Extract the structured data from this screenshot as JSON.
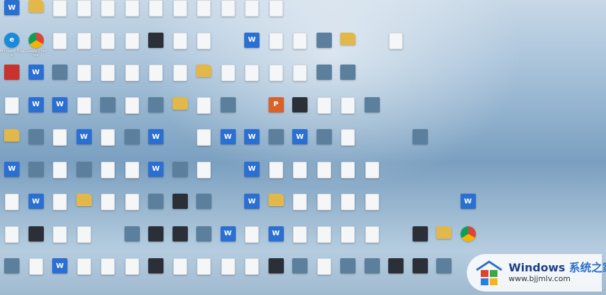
{
  "desktop": {
    "icons": [
      {
        "label": "",
        "kind": "word",
        "col": 0,
        "row": 0
      },
      {
        "label": "",
        "kind": "folder",
        "col": 1,
        "row": 0
      },
      {
        "label": "",
        "kind": "doc",
        "col": 2,
        "row": 0
      },
      {
        "label": "",
        "kind": "doc",
        "col": 3,
        "row": 0
      },
      {
        "label": "",
        "kind": "doc",
        "col": 4,
        "row": 0
      },
      {
        "label": "",
        "kind": "doc",
        "col": 5,
        "row": 0
      },
      {
        "label": "",
        "kind": "doc",
        "col": 6,
        "row": 0
      },
      {
        "label": "",
        "kind": "doc",
        "col": 7,
        "row": 0
      },
      {
        "label": "",
        "kind": "doc",
        "col": 8,
        "row": 0
      },
      {
        "label": "",
        "kind": "doc",
        "col": 9,
        "row": 0
      },
      {
        "label": "",
        "kind": "doc",
        "col": 10,
        "row": 0
      },
      {
        "label": "",
        "kind": "doc",
        "col": 11,
        "row": 0
      },
      {
        "label": "Microsoft Edge",
        "kind": "edge",
        "col": 0,
        "row": 1
      },
      {
        "label": "Google Chrome",
        "kind": "chrome",
        "col": 1,
        "row": 1
      },
      {
        "label": "",
        "kind": "doc",
        "col": 2,
        "row": 1
      },
      {
        "label": "",
        "kind": "doc",
        "col": 3,
        "row": 1
      },
      {
        "label": "",
        "kind": "doc",
        "col": 4,
        "row": 1
      },
      {
        "label": "",
        "kind": "doc",
        "col": 5,
        "row": 1
      },
      {
        "label": "",
        "kind": "dark",
        "col": 6,
        "row": 1
      },
      {
        "label": "",
        "kind": "doc",
        "col": 7,
        "row": 1
      },
      {
        "label": "",
        "kind": "doc",
        "col": 8,
        "row": 1
      },
      {
        "label": "",
        "kind": "word",
        "col": 10,
        "row": 1
      },
      {
        "label": "",
        "kind": "doc",
        "col": 11,
        "row": 1
      },
      {
        "label": "",
        "kind": "doc",
        "col": 12,
        "row": 1
      },
      {
        "label": "",
        "kind": "photo",
        "col": 13,
        "row": 1
      },
      {
        "label": "",
        "kind": "folder",
        "col": 14,
        "row": 1
      },
      {
        "label": "",
        "kind": "doc",
        "col": 16,
        "row": 1
      },
      {
        "label": "",
        "kind": "red",
        "col": 0,
        "row": 2
      },
      {
        "label": "",
        "kind": "word",
        "col": 1,
        "row": 2
      },
      {
        "label": "",
        "kind": "photo",
        "col": 2,
        "row": 2
      },
      {
        "label": "",
        "kind": "doc",
        "col": 3,
        "row": 2
      },
      {
        "label": "",
        "kind": "doc",
        "col": 4,
        "row": 2
      },
      {
        "label": "",
        "kind": "doc",
        "col": 5,
        "row": 2
      },
      {
        "label": "",
        "kind": "doc",
        "col": 6,
        "row": 2
      },
      {
        "label": "",
        "kind": "doc",
        "col": 7,
        "row": 2
      },
      {
        "label": "",
        "kind": "folder",
        "col": 8,
        "row": 2
      },
      {
        "label": "",
        "kind": "doc",
        "col": 9,
        "row": 2
      },
      {
        "label": "",
        "kind": "doc",
        "col": 10,
        "row": 2
      },
      {
        "label": "",
        "kind": "doc",
        "col": 11,
        "row": 2
      },
      {
        "label": "",
        "kind": "doc",
        "col": 12,
        "row": 2
      },
      {
        "label": "",
        "kind": "photo",
        "col": 13,
        "row": 2
      },
      {
        "label": "",
        "kind": "photo",
        "col": 14,
        "row": 2
      },
      {
        "label": "",
        "kind": "doc",
        "col": 0,
        "row": 3
      },
      {
        "label": "",
        "kind": "word",
        "col": 1,
        "row": 3
      },
      {
        "label": "",
        "kind": "word",
        "col": 2,
        "row": 3
      },
      {
        "label": "",
        "kind": "doc",
        "col": 3,
        "row": 3
      },
      {
        "label": "",
        "kind": "photo",
        "col": 4,
        "row": 3
      },
      {
        "label": "",
        "kind": "doc",
        "col": 5,
        "row": 3
      },
      {
        "label": "",
        "kind": "photo",
        "col": 6,
        "row": 3
      },
      {
        "label": "",
        "kind": "folder",
        "col": 7,
        "row": 3
      },
      {
        "label": "",
        "kind": "doc",
        "col": 8,
        "row": 3
      },
      {
        "label": "",
        "kind": "photo",
        "col": 9,
        "row": 3
      },
      {
        "label": "",
        "kind": "ppt",
        "col": 11,
        "row": 3
      },
      {
        "label": "",
        "kind": "dark",
        "col": 12,
        "row": 3
      },
      {
        "label": "",
        "kind": "doc",
        "col": 13,
        "row": 3
      },
      {
        "label": "",
        "kind": "doc",
        "col": 14,
        "row": 3
      },
      {
        "label": "",
        "kind": "photo",
        "col": 15,
        "row": 3
      },
      {
        "label": "",
        "kind": "folder",
        "col": 0,
        "row": 4
      },
      {
        "label": "",
        "kind": "photo",
        "col": 1,
        "row": 4
      },
      {
        "label": "",
        "kind": "doc",
        "col": 2,
        "row": 4
      },
      {
        "label": "",
        "kind": "word",
        "col": 3,
        "row": 4
      },
      {
        "label": "",
        "kind": "doc",
        "col": 4,
        "row": 4
      },
      {
        "label": "",
        "kind": "photo",
        "col": 5,
        "row": 4
      },
      {
        "label": "",
        "kind": "word",
        "col": 6,
        "row": 4
      },
      {
        "label": "",
        "kind": "doc",
        "col": 8,
        "row": 4
      },
      {
        "label": "",
        "kind": "word",
        "col": 9,
        "row": 4
      },
      {
        "label": "",
        "kind": "word",
        "col": 10,
        "row": 4
      },
      {
        "label": "",
        "kind": "photo",
        "col": 11,
        "row": 4
      },
      {
        "label": "",
        "kind": "word",
        "col": 12,
        "row": 4
      },
      {
        "label": "",
        "kind": "photo",
        "col": 13,
        "row": 4
      },
      {
        "label": "",
        "kind": "doc",
        "col": 14,
        "row": 4
      },
      {
        "label": "",
        "kind": "photo",
        "col": 17,
        "row": 4
      },
      {
        "label": "",
        "kind": "word",
        "col": 0,
        "row": 5
      },
      {
        "label": "",
        "kind": "photo",
        "col": 1,
        "row": 5
      },
      {
        "label": "",
        "kind": "doc",
        "col": 2,
        "row": 5
      },
      {
        "label": "",
        "kind": "photo",
        "col": 3,
        "row": 5
      },
      {
        "label": "",
        "kind": "doc",
        "col": 4,
        "row": 5
      },
      {
        "label": "",
        "kind": "doc",
        "col": 5,
        "row": 5
      },
      {
        "label": "",
        "kind": "word",
        "col": 6,
        "row": 5
      },
      {
        "label": "",
        "kind": "photo",
        "col": 7,
        "row": 5
      },
      {
        "label": "",
        "kind": "doc",
        "col": 8,
        "row": 5
      },
      {
        "label": "",
        "kind": "word",
        "col": 10,
        "row": 5
      },
      {
        "label": "",
        "kind": "doc",
        "col": 11,
        "row": 5
      },
      {
        "label": "",
        "kind": "doc",
        "col": 12,
        "row": 5
      },
      {
        "label": "",
        "kind": "doc",
        "col": 13,
        "row": 5
      },
      {
        "label": "",
        "kind": "doc",
        "col": 14,
        "row": 5
      },
      {
        "label": "",
        "kind": "doc",
        "col": 15,
        "row": 5
      },
      {
        "label": "",
        "kind": "doc",
        "col": 0,
        "row": 6
      },
      {
        "label": "",
        "kind": "word",
        "col": 1,
        "row": 6
      },
      {
        "label": "",
        "kind": "doc",
        "col": 2,
        "row": 6
      },
      {
        "label": "",
        "kind": "folder",
        "col": 3,
        "row": 6
      },
      {
        "label": "",
        "kind": "doc",
        "col": 4,
        "row": 6
      },
      {
        "label": "",
        "kind": "doc",
        "col": 5,
        "row": 6
      },
      {
        "label": "",
        "kind": "photo",
        "col": 6,
        "row": 6
      },
      {
        "label": "",
        "kind": "dark",
        "col": 7,
        "row": 6
      },
      {
        "label": "",
        "kind": "photo",
        "col": 8,
        "row": 6
      },
      {
        "label": "",
        "kind": "word",
        "col": 10,
        "row": 6
      },
      {
        "label": "",
        "kind": "folder",
        "col": 11,
        "row": 6
      },
      {
        "label": "",
        "kind": "doc",
        "col": 12,
        "row": 6
      },
      {
        "label": "",
        "kind": "doc",
        "col": 13,
        "row": 6
      },
      {
        "label": "",
        "kind": "doc",
        "col": 14,
        "row": 6
      },
      {
        "label": "",
        "kind": "doc",
        "col": 15,
        "row": 6
      },
      {
        "label": "",
        "kind": "word",
        "col": 19,
        "row": 6
      },
      {
        "label": "",
        "kind": "doc",
        "col": 0,
        "row": 7
      },
      {
        "label": "",
        "kind": "dark",
        "col": 1,
        "row": 7
      },
      {
        "label": "",
        "kind": "doc",
        "col": 2,
        "row": 7
      },
      {
        "label": "",
        "kind": "doc",
        "col": 3,
        "row": 7
      },
      {
        "label": "",
        "kind": "photo",
        "col": 5,
        "row": 7
      },
      {
        "label": "",
        "kind": "dark",
        "col": 6,
        "row": 7
      },
      {
        "label": "",
        "kind": "dark",
        "col": 7,
        "row": 7
      },
      {
        "label": "",
        "kind": "photo",
        "col": 8,
        "row": 7
      },
      {
        "label": "",
        "kind": "word",
        "col": 9,
        "row": 7
      },
      {
        "label": "",
        "kind": "doc",
        "col": 10,
        "row": 7
      },
      {
        "label": "",
        "kind": "word",
        "col": 11,
        "row": 7
      },
      {
        "label": "",
        "kind": "doc",
        "col": 12,
        "row": 7
      },
      {
        "label": "",
        "kind": "doc",
        "col": 13,
        "row": 7
      },
      {
        "label": "",
        "kind": "doc",
        "col": 14,
        "row": 7
      },
      {
        "label": "",
        "kind": "doc",
        "col": 15,
        "row": 7
      },
      {
        "label": "",
        "kind": "dark",
        "col": 17,
        "row": 7
      },
      {
        "label": "",
        "kind": "folder",
        "col": 18,
        "row": 7
      },
      {
        "label": "",
        "kind": "chrome",
        "col": 19,
        "row": 7
      },
      {
        "label": "",
        "kind": "photo",
        "col": 0,
        "row": 8
      },
      {
        "label": "",
        "kind": "doc",
        "col": 1,
        "row": 8
      },
      {
        "label": "",
        "kind": "word",
        "col": 2,
        "row": 8
      },
      {
        "label": "",
        "kind": "doc",
        "col": 3,
        "row": 8
      },
      {
        "label": "",
        "kind": "doc",
        "col": 4,
        "row": 8
      },
      {
        "label": "",
        "kind": "doc",
        "col": 5,
        "row": 8
      },
      {
        "label": "",
        "kind": "dark",
        "col": 6,
        "row": 8
      },
      {
        "label": "",
        "kind": "doc",
        "col": 7,
        "row": 8
      },
      {
        "label": "",
        "kind": "doc",
        "col": 8,
        "row": 8
      },
      {
        "label": "",
        "kind": "doc",
        "col": 9,
        "row": 8
      },
      {
        "label": "",
        "kind": "doc",
        "col": 10,
        "row": 8
      },
      {
        "label": "",
        "kind": "dark",
        "col": 11,
        "row": 8
      },
      {
        "label": "",
        "kind": "photo",
        "col": 12,
        "row": 8
      },
      {
        "label": "",
        "kind": "doc",
        "col": 13,
        "row": 8
      },
      {
        "label": "",
        "kind": "photo",
        "col": 14,
        "row": 8
      },
      {
        "label": "",
        "kind": "photo",
        "col": 15,
        "row": 8
      },
      {
        "label": "",
        "kind": "dark",
        "col": 16,
        "row": 8
      },
      {
        "label": "",
        "kind": "dark",
        "col": 17,
        "row": 8
      },
      {
        "label": "",
        "kind": "photo",
        "col": 18,
        "row": 8
      }
    ]
  },
  "watermark": {
    "brand": "Windows",
    "brand_suffix": "系统之家",
    "url": "www.bjjmlv.com"
  },
  "colors": {
    "word": "#2b6fd1",
    "folder": "#e3b84a",
    "doc": "#f4f6f8",
    "dark": "#2a2f38",
    "photo": "#5b7f9c",
    "red": "#c8332d",
    "ppt": "#d9622b",
    "edge": "#1b8ad8",
    "chrome": "#3a9a48"
  }
}
